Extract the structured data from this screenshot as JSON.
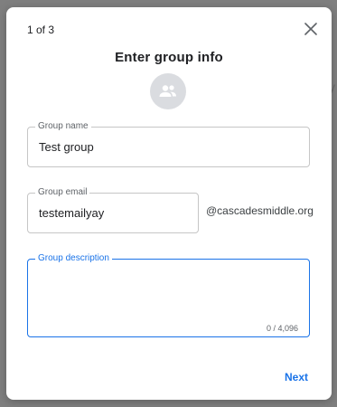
{
  "background": {
    "hint_text": "y"
  },
  "dialog": {
    "step": "1 of 3",
    "title": "Enter group info",
    "close_icon": "close-icon",
    "avatar_icon": "group-icon",
    "fields": {
      "group_name": {
        "label": "Group name",
        "value": "Test group"
      },
      "group_email": {
        "label": "Group email",
        "value": "testemailyay",
        "domain": "@cascadesmiddle.org"
      },
      "group_description": {
        "label": "Group description",
        "value": "",
        "counter": "0 / 4,096"
      }
    },
    "next_label": "Next"
  },
  "colors": {
    "accent": "#1a73e8",
    "overlay": "#7f7f7f",
    "border": "#c6c6c6"
  }
}
